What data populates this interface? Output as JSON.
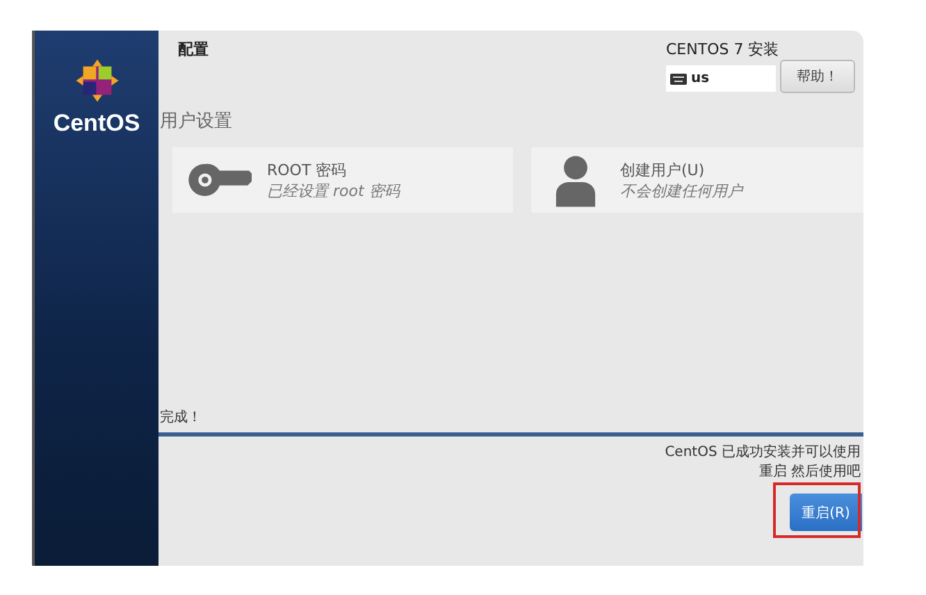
{
  "sidebar": {
    "logo_text": "CentOS"
  },
  "header": {
    "title": "配置",
    "product": "CENTOS 7 安装",
    "keyboard": "us",
    "help_button": "帮助！"
  },
  "section_title": "用户设置",
  "spokes": [
    {
      "kind": "key",
      "title": "ROOT 密码",
      "status": "已经设置 root 密码"
    },
    {
      "kind": "user",
      "title": "创建用户(U)",
      "status": "不会创建任何用户"
    }
  ],
  "progress": {
    "label": "完成！",
    "level": 1
  },
  "messages": [
    "CentOS 已成功安装并可以使用",
    "重启 然后使用吧"
  ],
  "reboot_button": {
    "label": "重启(R)",
    "highlighted": true
  }
}
